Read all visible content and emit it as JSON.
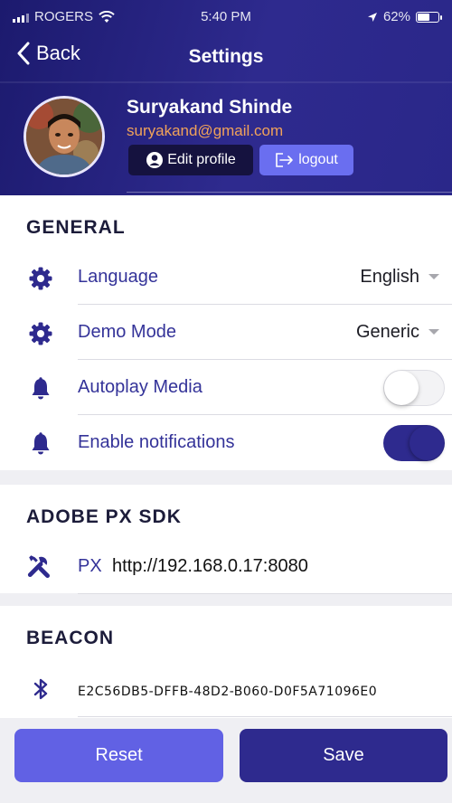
{
  "status_bar": {
    "carrier": "ROGERS",
    "time": "5:40 PM",
    "battery": "62%",
    "battery_level": 0.62,
    "icons": [
      "signal-icon",
      "wifi-icon",
      "location-arrow-icon",
      "battery-icon"
    ]
  },
  "nav": {
    "back_label": "Back",
    "title": "Settings"
  },
  "profile": {
    "name": "Suryakand Shinde",
    "email": "suryakand@gmail.com",
    "edit_label": "Edit profile",
    "logout_label": "logout"
  },
  "general": {
    "title": "GENERAL",
    "language": {
      "label": "Language",
      "value": "English",
      "icon": "gear-icon"
    },
    "demo_mode": {
      "label": "Demo Mode",
      "value": "Generic",
      "icon": "gear-icon"
    },
    "autoplay": {
      "label": "Autoplay Media",
      "enabled": false,
      "icon": "bell-icon"
    },
    "notifications": {
      "label": "Enable notifications",
      "enabled": true,
      "icon": "bell-icon"
    }
  },
  "adobe": {
    "title": "ADOBE PX SDK",
    "px_label": "PX",
    "px_value": "http://192.168.0.17:8080",
    "icon": "tools-icon"
  },
  "beacon": {
    "title": "BEACON",
    "uuid": "E2C56DB5-DFFB-48D2-B060-D0F5A71096E0",
    "icon": "bluetooth-icon"
  },
  "actions": {
    "reset_label": "Reset",
    "save_label": "Save"
  },
  "colors": {
    "primary": "#2e2a8e",
    "accent": "#6161e4",
    "email": "#f0a25a",
    "label": "#343399"
  }
}
